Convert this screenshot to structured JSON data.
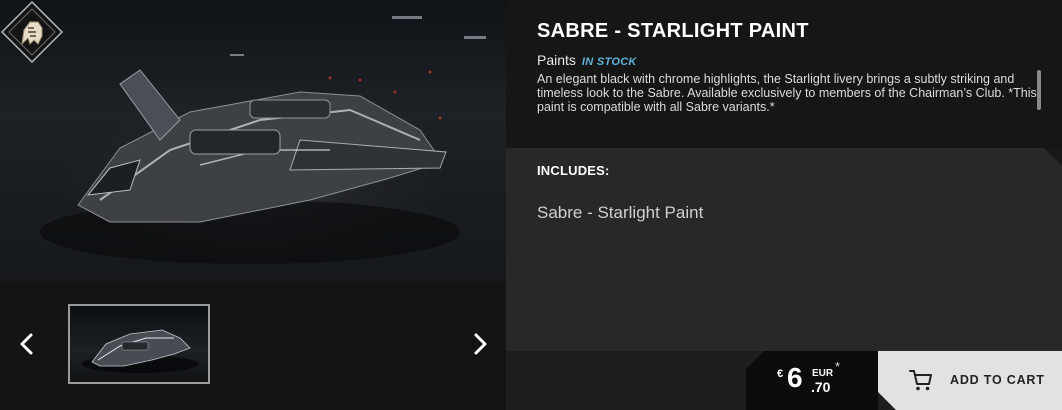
{
  "product": {
    "title": "SABRE - STARLIGHT PAINT",
    "category": "Paints",
    "stock_status": "IN STOCK",
    "description": "An elegant black with chrome highlights, the Starlight livery brings a subtly striking and timeless look to the Sabre. Available exclusively to members of the Chairman’s Club. *This paint is compatible with all Sabre variants.*"
  },
  "includes": {
    "label": "INCLUDES:",
    "items": [
      "Sabre - Starlight Paint"
    ]
  },
  "price": {
    "currency_symbol": "€",
    "whole": "6",
    "currency_code": "EUR",
    "cents": ".70",
    "footnote_mark": "*"
  },
  "cart": {
    "label": "ADD TO CART"
  },
  "gallery": {
    "icons": {
      "prev": "chevron-left-icon",
      "next": "chevron-right-icon",
      "badge": "chairmans-club-lion-icon",
      "cart": "cart-icon"
    }
  },
  "colors": {
    "stock_accent": "#5fb3d9",
    "cart_button": "#e2e2e2",
    "price_box": "#0c0c0c"
  }
}
